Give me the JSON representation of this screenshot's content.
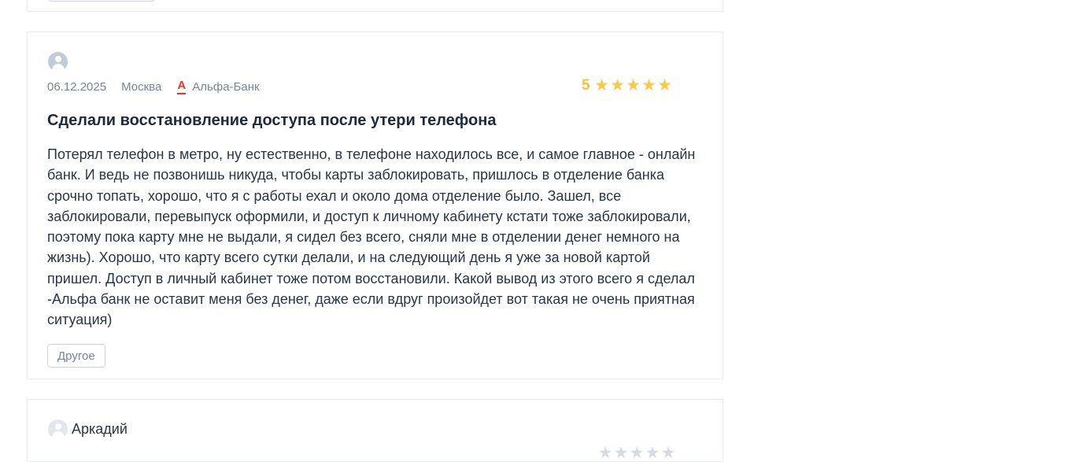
{
  "reviews": [
    {
      "date": "06.12.2025",
      "city": "Москва",
      "bank": "Альфа-Банк",
      "bank_logo": "А",
      "rating": "5",
      "stars_filled": 5,
      "title": "Сделали восстановление доступа после утери телефона",
      "text": "Потерял телефон в метро, ну естественно, в телефоне находилось все, и самое главное - онлайн банк. И ведь не позвонишь никуда, чтобы карты заблокировать, пришлось в отделение банка срочно топать, хорошо, что я с работы ехал и около дома отделение было. Зашел, все заблокировали, перевыпуск оформили, и доступ к личному кабинету кстати тоже заблокировали, поэтому пока карту мне не выдали, я сидел без всего, сняли мне в отделении денег немного на жизнь). Хорошо, что карту всего сутки делали, и на следующий день я уже за новой картой пришел. Доступ в личный кабинет тоже потом восстановили. Какой вывод из этого всего я сделал -Альфа банк не оставит меня без денег, даже если вдруг произойдет вот такая не очень приятная ситуация)",
      "tag": "Другое"
    },
    {
      "author": "Аркадий"
    }
  ],
  "colors": {
    "star": "#f7c948",
    "rating_number": "#f5c23e",
    "bank_logo": "#ef3124",
    "border": "#e8ebef"
  }
}
